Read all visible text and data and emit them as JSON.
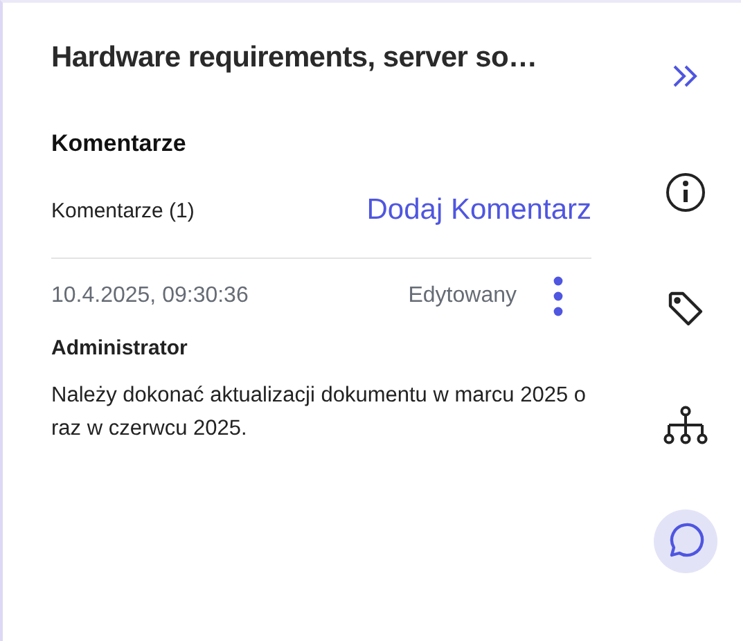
{
  "panel": {
    "title": "Hardware requirements, server so…",
    "section_title": "Komentarze",
    "comment_count": "Komentarze (1)",
    "add_link": "Dodaj Komentarz"
  },
  "comments": [
    {
      "date": "10.4.2025, 09:30:36",
      "status": "Edytowany",
      "author": "Administrator",
      "text": "Należy dokonać aktualizacji dokumentu w marcu 2025 oraz w czerwcu 2025."
    }
  ],
  "rail": [
    {
      "kind": "collapse",
      "selected": false
    },
    {
      "kind": "info",
      "selected": false
    },
    {
      "kind": "tag",
      "selected": false
    },
    {
      "kind": "hierarchy",
      "selected": false
    },
    {
      "kind": "comments",
      "selected": true
    }
  ]
}
